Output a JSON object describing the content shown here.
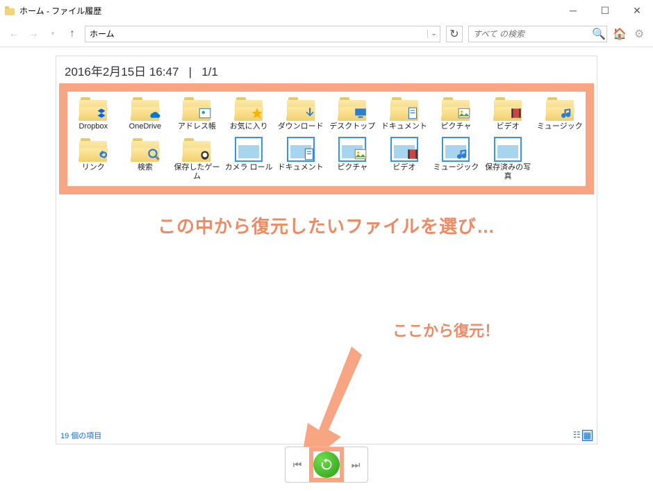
{
  "window": {
    "title": "ホーム - ファイル履歴"
  },
  "nav": {
    "address": "ホーム",
    "search_placeholder": "すべて の検索"
  },
  "header": {
    "datetime": "2016年2月15日 16:47",
    "sep": "|",
    "page": "1/1"
  },
  "items_row1": [
    {
      "name": "Dropbox",
      "type": "folder",
      "overlay": "dropbox"
    },
    {
      "name": "OneDrive",
      "type": "folder",
      "overlay": "cloud"
    },
    {
      "name": "アドレス帳",
      "type": "folder",
      "overlay": "contact"
    },
    {
      "name": "お気に入り",
      "type": "folder",
      "overlay": "star"
    },
    {
      "name": "ダウンロード",
      "type": "folder",
      "overlay": "download"
    },
    {
      "name": "デスクトップ",
      "type": "folder",
      "overlay": "desktop"
    },
    {
      "name": "ドキュメント",
      "type": "folder",
      "overlay": "doc"
    },
    {
      "name": "ピクチャ",
      "type": "folder",
      "overlay": "pic"
    },
    {
      "name": "ビデオ",
      "type": "folder",
      "overlay": "video"
    },
    {
      "name": "ミュージック",
      "type": "folder",
      "overlay": "music"
    }
  ],
  "items_row2": [
    {
      "name": "リンク",
      "type": "folder",
      "overlay": "link"
    },
    {
      "name": "検索",
      "type": "folder",
      "overlay": "search"
    },
    {
      "name": "保存したゲーム",
      "type": "folder",
      "overlay": "game"
    },
    {
      "name": "カメラ ロール",
      "type": "library"
    },
    {
      "name": "ドキュメント",
      "type": "library",
      "overlay": "doc"
    },
    {
      "name": "ピクチャ",
      "type": "library",
      "overlay": "pic"
    },
    {
      "name": "ビデオ",
      "type": "library",
      "overlay": "video"
    },
    {
      "name": "ミュージック",
      "type": "library",
      "overlay": "music"
    },
    {
      "name": "保存済みの写真",
      "type": "library"
    }
  ],
  "annotation": {
    "line1": "この中から復元したいファイルを選び…",
    "line2": "ここから復元！"
  },
  "status": {
    "count": "19 個の項目"
  }
}
